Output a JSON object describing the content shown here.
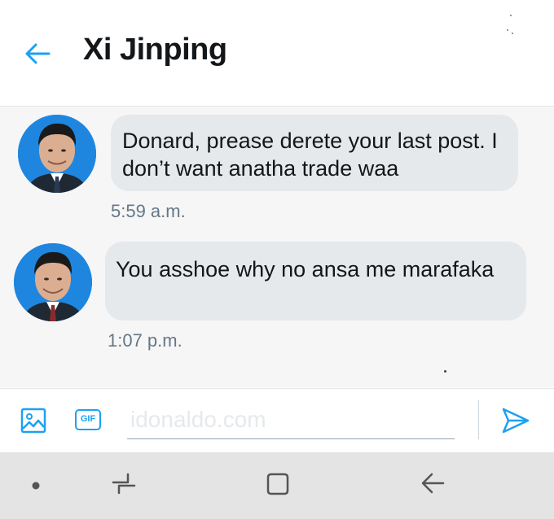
{
  "header": {
    "title": "Xi Jinping",
    "back_icon": "arrow-left-icon"
  },
  "messages": [
    {
      "text": "Donard, prease derete your last post. I don’t want anatha trade waa",
      "time": "5:59 a.m.",
      "avatar": "avatar-photo"
    },
    {
      "text": "You asshoe why no ansa me marafaka",
      "time": "1:07 p.m.",
      "avatar": "avatar-photo"
    }
  ],
  "composer": {
    "media_icon": "image-icon",
    "gif_label": "GIF",
    "placeholder": "idonaldo.com",
    "send_icon": "send-icon"
  },
  "navbar": {
    "items": [
      "dot-icon",
      "recent-apps-icon",
      "home-icon",
      "back-icon"
    ]
  },
  "colors": {
    "accent": "#1da1f2",
    "bubble": "#e6e9ec",
    "text": "#14171a",
    "secondary_text": "#657786"
  }
}
